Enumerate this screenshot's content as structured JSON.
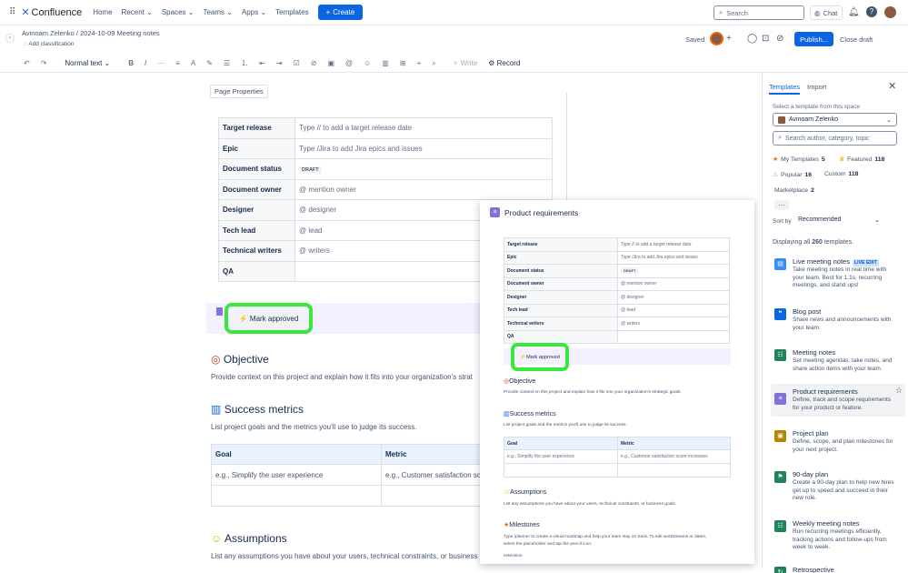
{
  "nav": {
    "logo": "Confluence",
    "links": [
      "Home",
      "Recent",
      "Spaces",
      "Teams",
      "Apps",
      "Templates"
    ],
    "create_label": "Create",
    "search_placeholder": "Search",
    "chat_label": "Chat"
  },
  "page_bar": {
    "breadcrumb_user": "Avinoam Zelenko",
    "breadcrumb_page": "2024-10-09 Meeting notes",
    "add_classification": "Add classification",
    "saved": "Saved",
    "publish": "Publish...",
    "close_draft": "Close draft"
  },
  "toolbar": {
    "text_style": "Normal text",
    "write": "Write",
    "record": "Record"
  },
  "editor": {
    "page_properties_label": "Page Properties",
    "properties": [
      {
        "key": "Target release",
        "value": "Type // to add a target release date"
      },
      {
        "key": "Epic",
        "value": "Type /Jira to add Jira epics and issues"
      },
      {
        "key": "Document status",
        "value": "DRAFT"
      },
      {
        "key": "Document owner",
        "value": "@ mention owner"
      },
      {
        "key": "Designer",
        "value": "@ designer"
      },
      {
        "key": "Tech lead",
        "value": "@ lead"
      },
      {
        "key": "Technical writers",
        "value": "@ writers"
      },
      {
        "key": "QA",
        "value": ""
      }
    ],
    "mark_approved": "Mark approved",
    "objective_heading": "Objective",
    "objective_text": "Provide context on this project and explain how it fits into your organization's strat",
    "success_heading": "Success metrics",
    "success_text": "List project goals and the metrics you'll use to judge its success.",
    "goal_headers": [
      "Goal",
      "Metric"
    ],
    "goal_row": [
      "e.g., Simplify the user experience",
      "e.g., Customer satisfaction sc"
    ],
    "assumptions_heading": "Assumptions",
    "assumptions_text": "List any assumptions you have about your users, technical constraints, or business"
  },
  "preview": {
    "title": "Product requirements",
    "properties": [
      {
        "key": "Target release",
        "value": "Type // to add a target release date"
      },
      {
        "key": "Epic",
        "value": "Type /Jira to add Jira epics and issues"
      },
      {
        "key": "Document status",
        "value": "DRAFT"
      },
      {
        "key": "Document owner",
        "value": "@ mention owner"
      },
      {
        "key": "Designer",
        "value": "@ designer"
      },
      {
        "key": "Tech lead",
        "value": "@ lead"
      },
      {
        "key": "Technical writers",
        "value": "@ writers"
      },
      {
        "key": "QA",
        "value": ""
      }
    ],
    "mark_approved": "Mark approved",
    "objective_heading": "Objective",
    "objective_text": "Provide context on this project and explain how it fits into your organization's strategic goals.",
    "success_heading": "Success metrics",
    "success_text": "List project goals and the metrics you'll use to judge its success.",
    "goal_headers": [
      "Goal",
      "Metric"
    ],
    "goal_row": [
      "e.g., Simplify the user experience",
      "e.g., Customer satisfaction score increases"
    ],
    "assumptions_heading": "Assumptions",
    "assumptions_text": "List any assumptions you have about your users, technical constraints, or business goals.",
    "milestones_heading": "Milestones",
    "milestones_text_1": "Type /planner to create a visual roadmap and help your team stay on track. To edit workstreams or dates,",
    "milestones_text_2": "select the placeholder and tap the pencil icon.",
    "extension": "extension"
  },
  "panel": {
    "tabs": [
      "Templates",
      "Import"
    ],
    "space_label": "Select a template from this space",
    "space_value": "Avinoam Zelenko",
    "search_placeholder": "Search author, category, topic",
    "filters": [
      {
        "label": "My Templates",
        "count": "5"
      },
      {
        "label": "Featured",
        "count": "118"
      },
      {
        "label": "Popular",
        "count": "16"
      },
      {
        "label": "Custom",
        "count": "118"
      },
      {
        "label": "Marketplace",
        "count": "2"
      }
    ],
    "sort_label": "Sort by",
    "sort_value": "Recommended",
    "displaying_prefix": "Displaying all ",
    "displaying_count": "260",
    "displaying_suffix": " templates.",
    "templates": [
      {
        "name": "Live meeting notes",
        "badge": "LIVE EDIT",
        "desc": "Take meeting notes in real time with your team. Best for 1:1s, recurring meetings, and stand ups!",
        "color": "#388bff"
      },
      {
        "name": "Blog post",
        "badge": "",
        "desc": "Share news and announcements with your team.",
        "color": "#0c66e4"
      },
      {
        "name": "Meeting notes",
        "badge": "",
        "desc": "Set meeting agendas, take notes, and share action items with your team.",
        "color": "#1f845a"
      },
      {
        "name": "Product requirements",
        "badge": "",
        "desc": "Define, track and scope requirements for your product or feature.",
        "color": "#8270db"
      },
      {
        "name": "Project plan",
        "badge": "",
        "desc": "Define, scope, and plan milestones for your next project.",
        "color": "#b38600"
      },
      {
        "name": "90-day plan",
        "badge": "",
        "desc": "Create a 90-day plan to help new hires get up to speed and succeed in their new role.",
        "color": "#1f845a"
      },
      {
        "name": "Weekly meeting notes",
        "badge": "",
        "desc": "Run recurring meetings efficiently, tracking actions and follow-ups from week to week.",
        "color": "#1f845a"
      },
      {
        "name": "Retrospective",
        "badge": "",
        "desc": "",
        "color": "#1f845a"
      }
    ]
  }
}
